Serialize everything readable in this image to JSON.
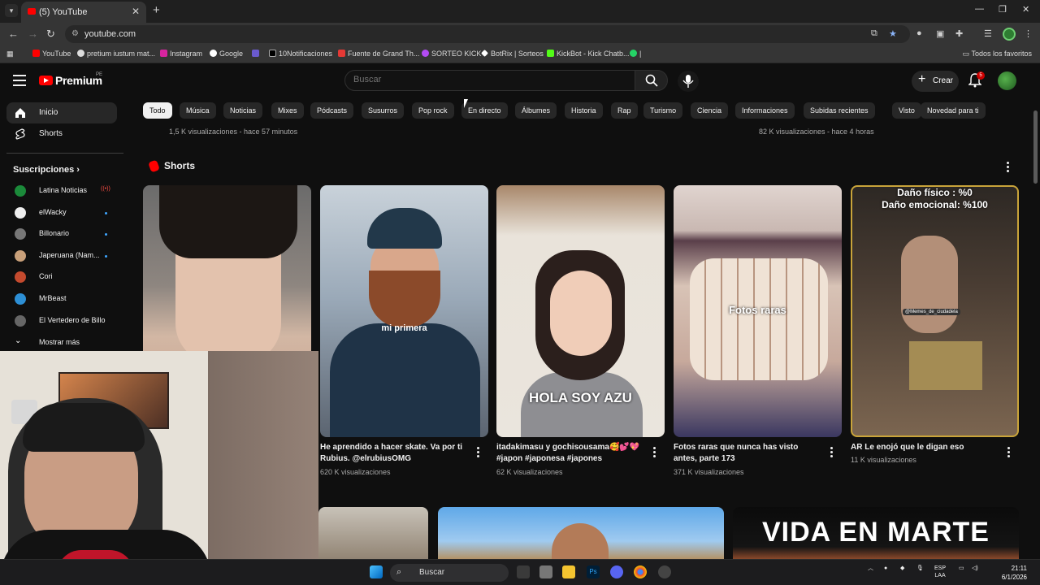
{
  "browser": {
    "tab_title": "(5) YouTube",
    "url": "youtube.com",
    "bookmarks": [
      "YouTube",
      "pretium iustum mat...",
      "Instagram",
      "Google",
      "10Notificaciones",
      "Fuente de Grand Th...",
      "SORTEO KICK",
      "BotRix | Sorteos",
      "KickBot - Kick Chatb...",
      "|"
    ],
    "bookmarks_folder": "Todos los favoritos"
  },
  "header": {
    "logo_text": "Premium",
    "region": "PE",
    "search_placeholder": "Buscar",
    "create_label": "Crear",
    "notification_count": "5"
  },
  "sidebar": {
    "main_items": [
      {
        "label": "Inicio",
        "icon": "home-icon",
        "active": true
      },
      {
        "label": "Shorts",
        "icon": "shorts-icon",
        "active": false
      }
    ],
    "subscriptions_heading": "Suscripciones",
    "subscriptions": [
      {
        "label": "Latina Noticias",
        "color": "#1b8a3a",
        "status": "live"
      },
      {
        "label": "elWacky",
        "color": "#eeeeee",
        "status": "new"
      },
      {
        "label": "Billonario",
        "color": "#777777",
        "status": "new"
      },
      {
        "label": "Japeruana (Nam...",
        "color": "#c9a07a",
        "status": "new"
      },
      {
        "label": "Cori",
        "color": "#c44a2e",
        "status": ""
      },
      {
        "label": "MrBeast",
        "color": "#2d8fd5",
        "status": ""
      },
      {
        "label": "El Vertedero de Billo",
        "color": "#666666",
        "status": ""
      }
    ],
    "show_more": "Mostrar más"
  },
  "chips": [
    "Todo",
    "Música",
    "Noticias",
    "Mixes",
    "Pódcasts",
    "Susurros",
    "Pop rock",
    "En directo",
    "Álbumes",
    "Historia",
    "Rap",
    "Turismo",
    "Ciencia",
    "Informaciones",
    "Subidas recientes",
    "Visto",
    "Novedad para ti"
  ],
  "prev_row_meta": [
    "1,5 K visualizaciones - hace 57 minutos",
    "82 K visualizaciones - hace 4 horas"
  ],
  "shorts": {
    "title": "Shorts",
    "items": [
      {
        "title": "",
        "views": "",
        "overlay": ""
      },
      {
        "title": "He aprendido a hacer skate. Va por ti Rubius. @elrubiusOMG",
        "views": "620 K visualizaciones",
        "overlay": "mi primera"
      },
      {
        "title": "itadakimasu y gochisousama🥰💕💖 #japon #japonesa #japones",
        "views": "62 K visualizaciones",
        "overlay": "HOLA SOY AZU"
      },
      {
        "title": "Fotos raras que nunca has visto antes, parte 173",
        "views": "371 K visualizaciones",
        "overlay": "Fotos raras"
      },
      {
        "title": "AR Le enojó que le digan eso",
        "views": "11 K visualizaciones",
        "overlay_top_1": "Daño físico : %0",
        "overlay_top_2": "Daño emocional: %100",
        "watermark": "@Memes_de_ciudadela"
      }
    ]
  },
  "bottom_row": {
    "vida_title": "VIDA EN MARTE"
  },
  "taskbar": {
    "search": "Buscar",
    "lang_1": "ESP",
    "lang_2": "LAA",
    "time": "21:11",
    "date": "6/1/2026"
  }
}
